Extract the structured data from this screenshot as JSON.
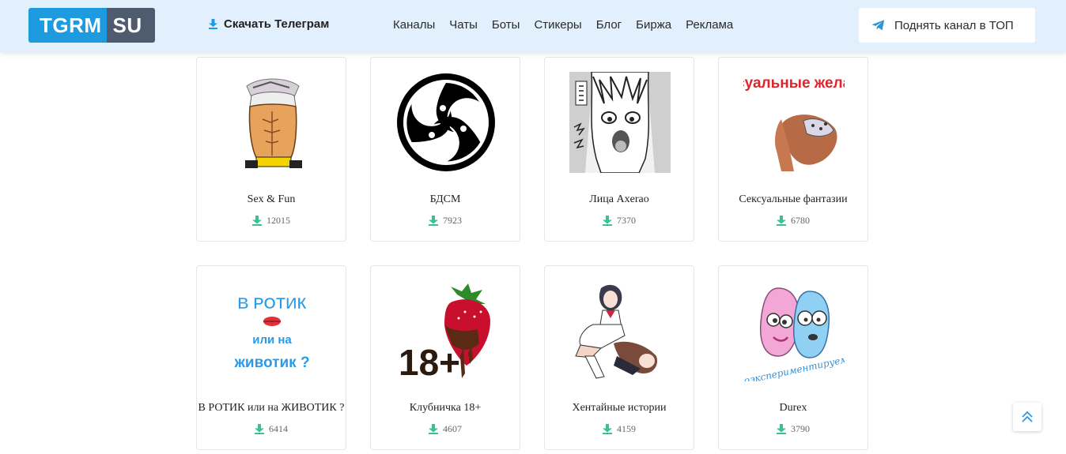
{
  "header": {
    "logo_left": "TGRM",
    "logo_right": "SU",
    "download_label": "Скачать Телеграм",
    "nav": [
      "Каналы",
      "Чаты",
      "Боты",
      "Стикеры",
      "Блог",
      "Биржа",
      "Реклама"
    ],
    "promo_label": "Поднять канал в ТОП"
  },
  "colors": {
    "header_bg": "#e1f0fc",
    "logo_blue": "#1e9be0",
    "logo_gray": "#4f5c6f",
    "download_green": "#3bbf97",
    "telegram_blue": "#2f95d6"
  },
  "thumb_texts": {
    "red_title": "Сексуальные желания",
    "blue_1": "В РОТИК",
    "blue_2": "или на",
    "blue_3": "животик ?",
    "berry_18": "18+",
    "durex_caption": "Поэкспериментируем?"
  },
  "stickers": [
    {
      "title": "Sex & Fun",
      "count": "12015",
      "icon": "sticker-sex-fun"
    },
    {
      "title": "БДСМ",
      "count": "7923",
      "icon": "bdsm-triskelion"
    },
    {
      "title": "Лица Axerao",
      "count": "7370",
      "icon": "manga-face"
    },
    {
      "title": "Сексуальные фантазии",
      "count": "6780",
      "icon": "sticker-fantasies"
    },
    {
      "title": "В РОТИК или на ЖИВОТИК ?",
      "count": "6414",
      "icon": "sticker-text-lips"
    },
    {
      "title": "Клубничка 18+",
      "count": "4607",
      "icon": "strawberry-18"
    },
    {
      "title": "Хентайные истории",
      "count": "4159",
      "icon": "anime-girl"
    },
    {
      "title": "Durex",
      "count": "3790",
      "icon": "durex-characters"
    }
  ]
}
